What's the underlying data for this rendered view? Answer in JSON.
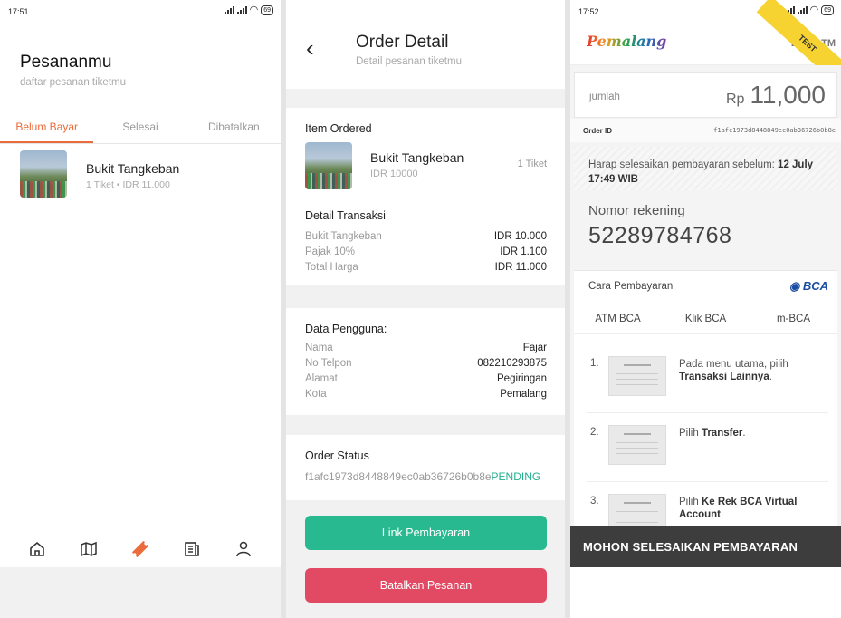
{
  "screen1": {
    "status_time": "17:51",
    "battery": "69",
    "title": "Pesananmu",
    "subtitle": "daftar pesanan tiketmu",
    "tabs": [
      "Belum Bayar",
      "Selesai",
      "Dibatalkan"
    ],
    "active_tab": "Belum Bayar",
    "order": {
      "name": "Bukit Tangkeban",
      "meta": "1 Tiket • IDR 11.000"
    },
    "nav_icons": [
      "home-icon",
      "map-icon",
      "ticket-icon",
      "news-icon",
      "profile-icon"
    ],
    "accent_color": "#ea6b3b"
  },
  "screen2": {
    "title": "Order Detail",
    "subtitle": "Detail pesanan tiketmu",
    "item_section": "Item Ordered",
    "item": {
      "name": "Bukit Tangkeban",
      "price": "IDR 10000",
      "qty": "1 Tiket"
    },
    "transaction_section": "Detail Transaksi",
    "transaction_rows": [
      {
        "k": "Bukit Tangkeban",
        "v": "IDR 10.000"
      },
      {
        "k": "Pajak 10%",
        "v": "IDR 1.100"
      },
      {
        "k": "Total Harga",
        "v": "IDR 11.000"
      }
    ],
    "user_section": "Data Pengguna:",
    "user_rows": [
      {
        "k": "Nama",
        "v": "Fajar"
      },
      {
        "k": "No Telpon",
        "v": "082210293875"
      },
      {
        "k": "Alamat",
        "v": "Pegiringan"
      },
      {
        "k": "Kota",
        "v": "Pemalang"
      }
    ],
    "status_section": "Order Status",
    "order_id": "f1afc1973d8448849ec0ab36726b0b8e",
    "status": "PENDING",
    "pay_button": "Link Pembayaran",
    "cancel_button": "Batalkan Pesanan",
    "pay_color": "#28b990",
    "cancel_color": "#e24a64"
  },
  "screen3": {
    "status_time": "17:52",
    "battery": "69",
    "logo": "Pemalang",
    "header_right": "BCA ATM",
    "ribbon": "TEST",
    "amount_label": "jumlah",
    "currency": "Rp",
    "amount": "11,000",
    "order_id_label": "Order ID",
    "order_id": "f1afc1973d8448849ec0ab36726b0b8e",
    "deadline_prefix": "Harap selesaikan pembayaran sebelum: ",
    "deadline": "12 July 17:49 WIB",
    "va_label": "Nomor rekening",
    "va_number": "52289784768",
    "how_label": "Cara Pembayaran",
    "bank_logo": "BCA",
    "tabs": [
      "ATM BCA",
      "Klik BCA",
      "m-BCA"
    ],
    "steps": [
      {
        "n": "1.",
        "pre": "Pada menu utama, pilih ",
        "bold": "Transaksi Lainnya",
        "post": "."
      },
      {
        "n": "2.",
        "pre": "Pilih ",
        "bold": "Transfer",
        "post": "."
      },
      {
        "n": "3.",
        "pre": "Pilih ",
        "bold": "Ke Rek BCA Virtual Account",
        "post": "."
      }
    ],
    "banner": "MOHON SELESAIKAN PEMBAYARAN"
  }
}
